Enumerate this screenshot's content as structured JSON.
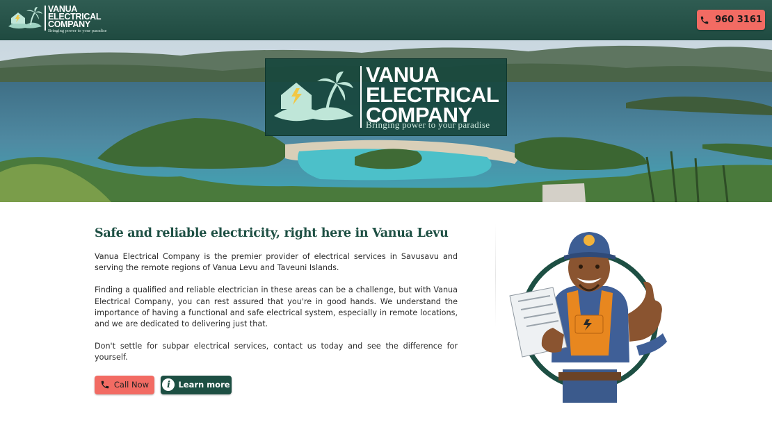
{
  "header": {
    "logo_line1": "VANUA",
    "logo_line2": "ELECTRICAL",
    "logo_line3": "COMPANY",
    "logo_tagline": "Bringing power to your paradise",
    "phone": "960 3161"
  },
  "hero": {
    "logo_line1": "VANUA",
    "logo_line2": "ELECTRICAL",
    "logo_line3": "COMPANY",
    "tagline": "Bringing power to your paradise"
  },
  "main": {
    "headline": "Safe and reliable electricity, right here in Vanua Levu",
    "para1": "Vanua Electrical Company is the premier provider of electrical services in Savusavu and serving the remote regions of Vanua Levu and Taveuni Islands.",
    "para2": "Finding a qualified and reliable electrician in these areas can be a challenge, but with Vanua Electrical Company, you can rest assured that you're in good hands. We understand the importance of having a functional and safe electrical system, especially in remote locations, and we are dedicated to delivering just that.",
    "para3": "Don't settle for subpar electrical services, contact us today and see the difference for yourself.",
    "call_label": "Call Now",
    "learn_label": "Learn more"
  },
  "colors": {
    "brand_green": "#1d4f43",
    "accent_coral": "#f26b63"
  },
  "icons": [
    "phone-icon",
    "info-icon",
    "house-lightning-icon",
    "palm-tree-icon"
  ]
}
